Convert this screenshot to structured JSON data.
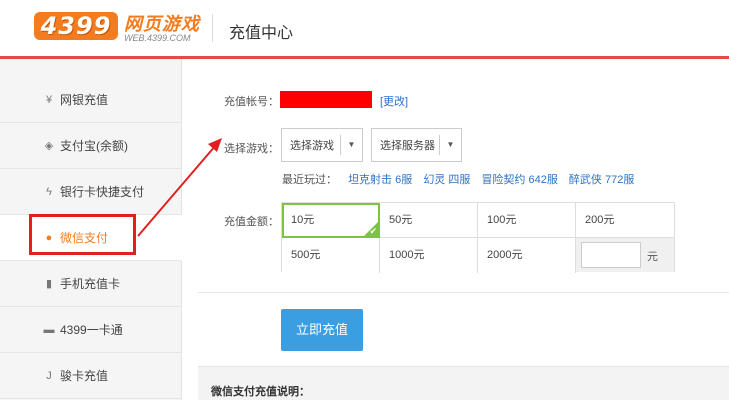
{
  "header": {
    "logo_number": "4399",
    "logo_text": "网页游戏",
    "logo_url": "WEB.4399.COM",
    "title": "充值中心"
  },
  "sidebar": {
    "items": [
      {
        "icon": "yen-icon",
        "glyph": "¥",
        "label": "网银充值"
      },
      {
        "icon": "alipay-icon",
        "glyph": "◈",
        "label": "支付宝(余额)"
      },
      {
        "icon": "lightning-icon",
        "glyph": "ϟ",
        "label": "银行卡快捷支付"
      },
      {
        "icon": "wechat-icon",
        "glyph": "●",
        "label": "微信支付",
        "active": true
      },
      {
        "icon": "phone-icon",
        "glyph": "▮",
        "label": "手机充值卡"
      },
      {
        "icon": "card-icon",
        "glyph": "▬",
        "label": "4399一卡通"
      },
      {
        "icon": "j-icon",
        "glyph": "J",
        "label": "骏卡充值"
      }
    ]
  },
  "form": {
    "account_label": "充值帐号：",
    "change_link": "[更改]",
    "game_label": "选择游戏：",
    "game_select": "选择游戏",
    "server_select": "选择服务器",
    "recent_label": "最近玩过：",
    "recent_games": [
      "坦克射击 6服",
      "幻灵 四服",
      "冒险契约 642服",
      "醉武侠 772服"
    ],
    "amount_label": "充值金额：",
    "amounts_row1": [
      "10元",
      "50元",
      "100元",
      "200元"
    ],
    "amounts_row2": [
      "500元",
      "1000元",
      "2000元"
    ],
    "custom_unit": "元",
    "selected_amount": "10元",
    "submit_label": "立即充值",
    "notes_title": "微信支付充值说明："
  },
  "colors": {
    "brand": "#f47c20",
    "accent_line": "#e84a3f",
    "button": "#3a9ee0",
    "selected": "#7dc242",
    "annotation": "#e02020"
  }
}
